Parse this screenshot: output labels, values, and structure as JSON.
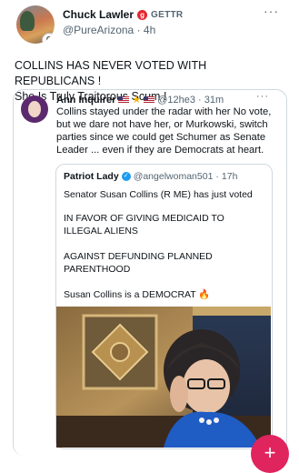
{
  "post": {
    "author_name": "Chuck Lawler",
    "platform_badge": "GETTR",
    "handle": "@PureArizona",
    "separator": "·",
    "time": "4h",
    "more_label": "···",
    "text_line1": "COLLINS HAS NEVER VOTED WITH REPUBLICANS !",
    "text_line2": "She Is Truly Traitorous Scum !"
  },
  "quote1": {
    "author_name": "Ann Inquirer",
    "handle": "@12he3",
    "separator": "·",
    "time": "31m",
    "more_label": "···",
    "lines": [
      "Collins stayed under the radar with her No vote,",
      "but we dare not have her, or Murkowski, switch",
      "parties since we could get Schumer as Senate",
      "Leader ... even if they are Democrats at heart."
    ]
  },
  "quote2": {
    "author_name": "Patriot Lady",
    "handle": "@angelwoman501",
    "separator": "·",
    "time": "17h",
    "line1": "Senator Susan Collins (R ME) has just voted",
    "line2": "IN FAVOR OF GIVING MEDICAID TO",
    "line3": "ILLEGAL ALIENS",
    "line4": "AGAINST DEFUNDING PLANNED",
    "line5": "PARENTHOOD",
    "line6": "Susan Collins is a DEMOCRAT",
    "fire_emoji": "🔥"
  },
  "fab": {
    "label": "+"
  },
  "colors": {
    "text": "#0f1419",
    "secondary": "#536471",
    "border": "#cfd9de",
    "verified": "#1d9bf0",
    "gettr_red": "#e5252d",
    "fab": "#e0245e"
  },
  "icons": [
    "gettr-icon",
    "us-flag-icon",
    "star-icon",
    "verified-icon",
    "fire-icon",
    "more-icon",
    "plus-icon"
  ]
}
